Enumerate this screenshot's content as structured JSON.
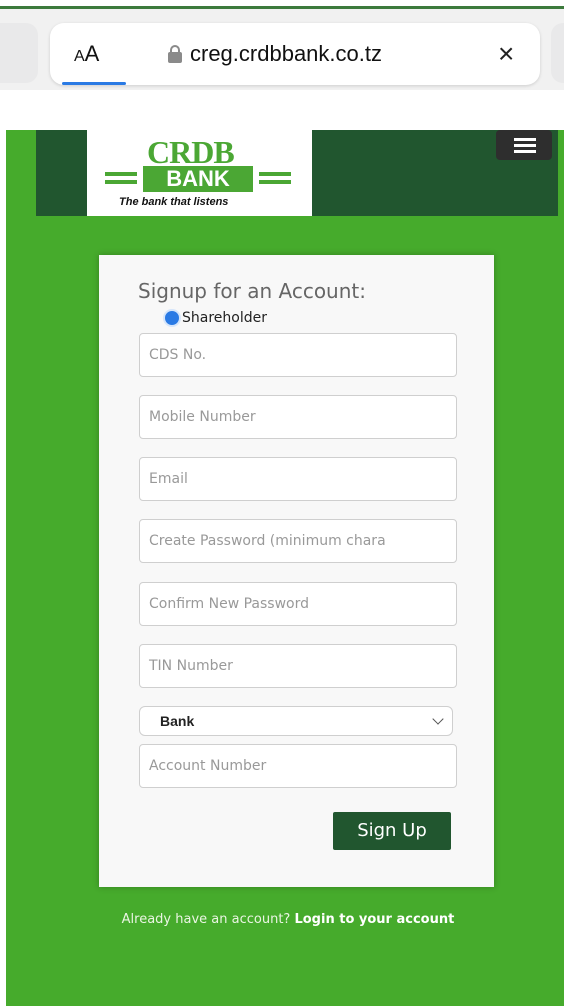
{
  "browser": {
    "text_size_label_small": "A",
    "text_size_label_large": "A",
    "url": "creg.crdbbank.co.tz",
    "close_glyph": "×"
  },
  "logo": {
    "brand": "CRDB",
    "bank": "BANK",
    "tagline": "The bank that listens",
    "color": "#4ba734"
  },
  "colors": {
    "page_bg": "#46ab2c",
    "header_bg": "#21562f",
    "button_bg": "#21562f",
    "radio_selected": "#2a7ae4"
  },
  "form": {
    "title": "Signup for an Account:",
    "account_type": {
      "label": "Shareholder",
      "selected": true
    },
    "fields": {
      "cds": "CDS No.",
      "mobile": "Mobile Number",
      "email": "Email",
      "password": "Create Password (minimum chara",
      "confirm_password": "Confirm New Password",
      "tin": "TIN Number",
      "account_number": "Account Number"
    },
    "bank_select": "Bank",
    "submit_label": "Sign Up"
  },
  "footer": {
    "prompt": "Already have an account?",
    "link": "Login to your account"
  },
  "icons": [
    "lock-icon",
    "close-icon",
    "hamburger-menu-icon",
    "chevron-down-icon"
  ]
}
